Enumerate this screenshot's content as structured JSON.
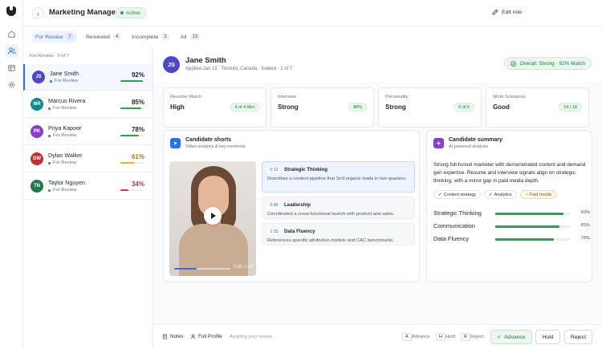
{
  "header": {
    "title": "Marketing Manager",
    "status": "Active",
    "edit_label": "Edit role"
  },
  "tabs": [
    {
      "label": "For Review",
      "count": "7"
    },
    {
      "label": "Reviewed",
      "count": "4"
    },
    {
      "label": "Incomplete",
      "count": "2"
    },
    {
      "label": "All",
      "count": "13"
    }
  ],
  "list": {
    "heading": "For Review · 5 of 7",
    "candidates": [
      {
        "initials": "JS",
        "name": "Jane Smith",
        "status": "For Review",
        "score": "92%",
        "score_value": 92,
        "avatar_color": "#5046c9",
        "score_color": "#1f2328",
        "bar_color": "#22a84a"
      },
      {
        "initials": "MR",
        "name": "Marcus Rivera",
        "status": "For Review",
        "score": "85%",
        "score_value": 85,
        "avatar_color": "#0e8a8a",
        "score_color": "#1f2328",
        "bar_color": "#22a84a"
      },
      {
        "initials": "PK",
        "name": "Priya Kapoor",
        "status": "For Review",
        "score": "78%",
        "score_value": 78,
        "avatar_color": "#8b3fd0",
        "score_color": "#1f2328",
        "bar_color": "#22a84a"
      },
      {
        "initials": "DW",
        "name": "Dylan Walker",
        "status": "For Review",
        "score": "61%",
        "score_value": 61,
        "avatar_color": "#c62f2f",
        "score_color": "#b07d00",
        "bar_color": "#e5b829"
      },
      {
        "initials": "TN",
        "name": "Taylor Nguyen",
        "status": "For Review",
        "score": "34%",
        "score_value": 34,
        "avatar_color": "#1f7a4a",
        "score_color": "#c62f2f",
        "bar_color": "#d93a3a"
      }
    ]
  },
  "candidate": {
    "initials": "JS",
    "name": "Jane Smith",
    "meta": "Applied Jan 15 · Toronto, Canada · Indeed · 1 of 7",
    "overall": "Overall: Strong · 92% Match"
  },
  "metrics": [
    {
      "label": "Resume Match",
      "value": "High",
      "badge": "4 of 4 Met"
    },
    {
      "label": "Interview",
      "value": "Strong",
      "badge": "88%"
    },
    {
      "label": "Personality",
      "value": "Strong",
      "badge": "5 of 5"
    },
    {
      "label": "Work Scenarios",
      "value": "Good",
      "badge": "14 / 18"
    }
  ],
  "shorts": {
    "title": "Candidate shorts",
    "subtitle": "Video analysis & key moments",
    "video_time": "0:38 / 1:42",
    "moments": [
      {
        "time": "0:12",
        "title": "Strategic Thinking",
        "desc": "Describes a content pipeline that 3x'd organic leads in two quarters."
      },
      {
        "time": "0:48",
        "title": "Leadership",
        "desc": "Coordinated a cross-functional launch with product and sales."
      },
      {
        "time": "1:35",
        "title": "Data Fluency",
        "desc": "References specific attribution models and CAC benchmarks."
      }
    ]
  },
  "summary": {
    "title": "Candidate summary",
    "subtitle": "AI powered analysis",
    "text": "Strong full-funnel marketer with demonstrated content and demand gen expertise. Resume and interview signals align on strategic thinking, with a minor gap in paid media depth.",
    "chips": [
      {
        "label": "Content strategy",
        "icon": "check-icon"
      },
      {
        "label": "Analytics",
        "icon": "check-icon"
      },
      {
        "label": "Paid media",
        "icon": "warning-icon"
      }
    ],
    "skills": [
      {
        "name": "Strategic Thinking",
        "value": "90%",
        "pct": 90
      },
      {
        "name": "Communication",
        "value": "85%",
        "pct": 85
      },
      {
        "name": "Data Fluency",
        "value": "78%",
        "pct": 78
      }
    ]
  },
  "footer": {
    "notes": "Notes",
    "full_profile": "Full Profile",
    "awaiting": "Awaiting your review",
    "shortcuts": [
      {
        "key": "A",
        "label": "Advance"
      },
      {
        "key": "H",
        "label": "Hold"
      },
      {
        "key": "R",
        "label": "Reject"
      }
    ],
    "advance": "Advance",
    "hold": "Hold",
    "reject": "Reject"
  },
  "colors": {
    "accent": "#2f6feb",
    "success": "#22a84a",
    "warning": "#e5b829",
    "danger": "#d93a3a"
  }
}
